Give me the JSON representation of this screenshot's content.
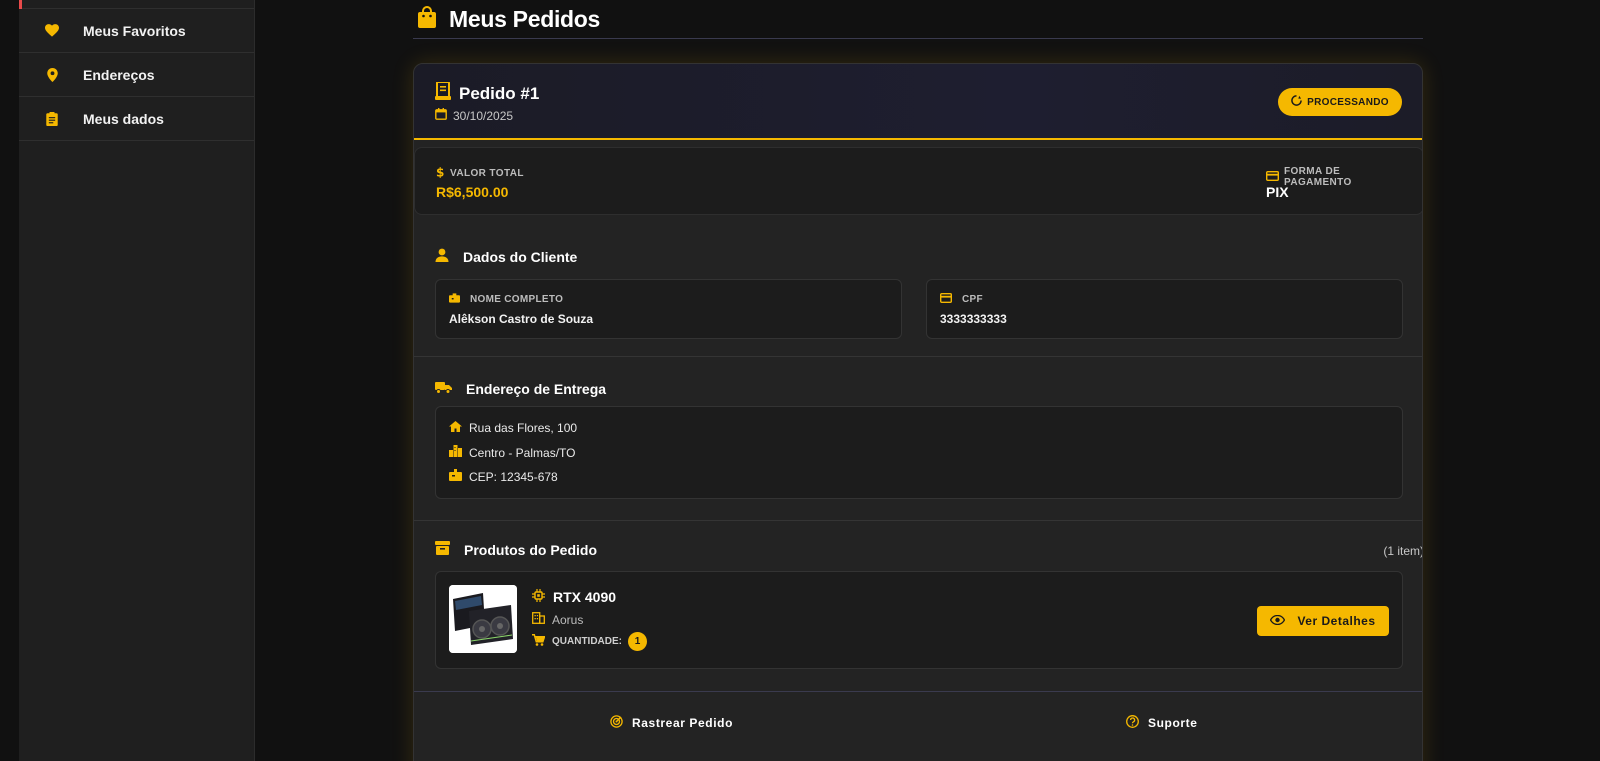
{
  "sidebar": {
    "items": [
      {
        "label": "Meus Favoritos",
        "icon": "heart-icon"
      },
      {
        "label": "Endereços",
        "icon": "map-pin-icon"
      },
      {
        "label": "Meus dados",
        "icon": "clipboard-icon"
      }
    ]
  },
  "page": {
    "title": "Meus Pedidos",
    "icon": "shopping-bag-icon"
  },
  "order": {
    "title": "Pedido #1",
    "date": "30/10/2025",
    "status": "PROCESSANDO",
    "total_label": "VALOR TOTAL",
    "total_value": "R$6,500.00",
    "payment_label": "FORMA DE PAGAMENTO",
    "payment_value": "PIX"
  },
  "customer": {
    "section_title": "Dados do Cliente",
    "name_label": "NOME COMPLETO",
    "name_value": "Alêkson Castro de Souza",
    "cpf_label": "CPF",
    "cpf_value": "3333333333"
  },
  "delivery": {
    "section_title": "Endereço de Entrega",
    "street": "Rua das Flores, 100",
    "district": "Centro - Palmas/TO",
    "zip": "CEP: 12345-678"
  },
  "products": {
    "section_title": "Produtos do Pedido",
    "count": "(1 item)",
    "items": [
      {
        "name": "RTX 4090",
        "brand": "Aorus",
        "qty_label": "QUANTIDADE:",
        "qty": "1",
        "button": "Ver Detalhes"
      }
    ]
  },
  "actions": {
    "track": "Rastrear Pedido",
    "support": "Suporte"
  },
  "colors": {
    "accent": "#f5b800",
    "background": "#111111",
    "sidebar": "#1f1f1f",
    "card": "#232323"
  }
}
